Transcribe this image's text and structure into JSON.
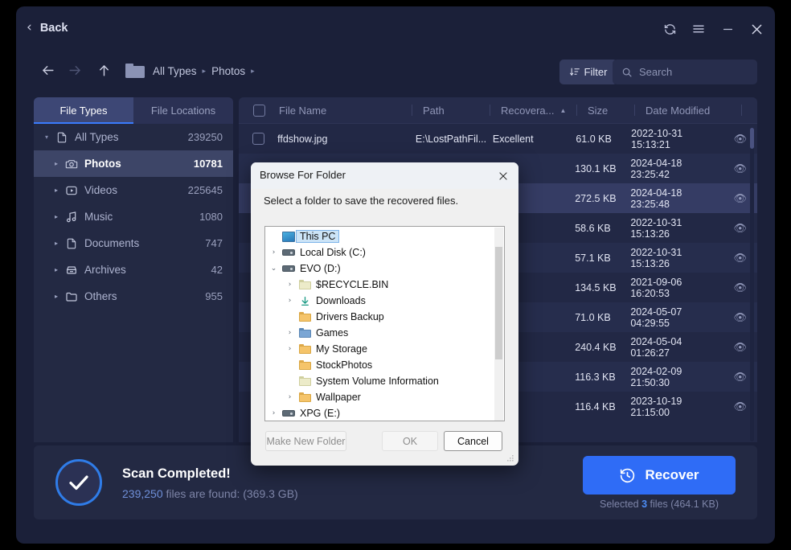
{
  "titlebar": {
    "back_label": "Back",
    "back_chevron": "‹",
    "refresh_icon": "refresh-icon",
    "menu_icon": "hamburger-menu-icon",
    "minimize_icon": "minimize-icon",
    "close_icon": "close-icon"
  },
  "toolbar": {
    "nav_back_icon": "arrow-left-icon",
    "nav_forward_icon": "arrow-right-icon",
    "nav_up_icon": "arrow-up-icon",
    "breadcrumb": [
      "All Types",
      "Photos"
    ],
    "breadcrumb_sep": "▸",
    "filter_label": "Filter",
    "search_placeholder": "Search"
  },
  "left_panel": {
    "tabs": [
      {
        "label": "File Types",
        "active": true
      },
      {
        "label": "File Locations",
        "active": false
      }
    ],
    "tree": [
      {
        "label": "All Types",
        "count": "239250",
        "icon": "document-icon",
        "expanded": true,
        "selected": false,
        "indent": false
      },
      {
        "label": "Photos",
        "count": "10781",
        "icon": "camera-icon",
        "expanded": false,
        "selected": true,
        "indent": true
      },
      {
        "label": "Videos",
        "count": "225645",
        "icon": "video-icon",
        "expanded": false,
        "selected": false,
        "indent": true
      },
      {
        "label": "Music",
        "count": "1080",
        "icon": "music-icon",
        "expanded": false,
        "selected": false,
        "indent": true
      },
      {
        "label": "Documents",
        "count": "747",
        "icon": "document-icon",
        "expanded": false,
        "selected": false,
        "indent": true
      },
      {
        "label": "Archives",
        "count": "42",
        "icon": "archive-icon",
        "expanded": false,
        "selected": false,
        "indent": true
      },
      {
        "label": "Others",
        "count": "955",
        "icon": "folder-icon",
        "expanded": false,
        "selected": false,
        "indent": true
      }
    ]
  },
  "table": {
    "columns": [
      "File Name",
      "Path",
      "Recovera...",
      "Size",
      "Date Modified"
    ],
    "sort_column": "Recovera...",
    "sort_direction": "asc",
    "sort_arrow": "▲",
    "header_checkbox_checked": false,
    "rows": [
      {
        "checked": false,
        "name": "ffdshow.jpg",
        "path": "E:\\LostPathFil...",
        "recoverability": "Excellent",
        "size": "61.0 KB",
        "date": "2022-10-31 15:13:21",
        "selected": false
      },
      {
        "checked": false,
        "name": "",
        "path": "",
        "recoverability": "",
        "size": "130.1 KB",
        "date": "2024-04-18 23:25:42",
        "selected": false
      },
      {
        "checked": true,
        "name": "",
        "path": "",
        "recoverability": "",
        "size": "272.5 KB",
        "date": "2024-04-18 23:25:48",
        "selected": true
      },
      {
        "checked": false,
        "name": "",
        "path": "",
        "recoverability": "",
        "size": "58.6 KB",
        "date": "2022-10-31 15:13:26",
        "selected": false
      },
      {
        "checked": true,
        "name": "",
        "path": "",
        "recoverability": "",
        "size": "57.1 KB",
        "date": "2022-10-31 15:13:26",
        "selected": false
      },
      {
        "checked": true,
        "name": "",
        "path": "",
        "recoverability": "",
        "size": "134.5 KB",
        "date": "2021-09-06 16:20:53",
        "selected": false
      },
      {
        "checked": false,
        "name": "",
        "path": "",
        "recoverability": "",
        "size": "71.0 KB",
        "date": "2024-05-07 04:29:55",
        "selected": false
      },
      {
        "checked": false,
        "name": "",
        "path": "",
        "recoverability": "",
        "size": "240.4 KB",
        "date": "2024-05-04 01:26:27",
        "selected": false
      },
      {
        "checked": false,
        "name": "",
        "path": "",
        "recoverability": "",
        "size": "116.3 KB",
        "date": "2024-02-09 21:50:30",
        "selected": false
      },
      {
        "checked": false,
        "name": "",
        "path": "",
        "recoverability": "",
        "size": "116.4 KB",
        "date": "2023-10-19 21:15:00",
        "selected": false
      }
    ],
    "eye_icon": "preview-eye-icon"
  },
  "bottom_bar": {
    "status_icon": "check-circle-icon",
    "title": "Scan Completed!",
    "found_count": "239,250",
    "found_rest": " files are found: (369.3 GB)",
    "recover_label": "Recover",
    "recover_icon": "restore-clock-icon",
    "selected_prefix": "Selected ",
    "selected_count": "3",
    "selected_suffix": " files (464.1 KB)"
  },
  "dialog": {
    "title": "Browse For Folder",
    "close_icon": "close-icon",
    "prompt": "Select a folder to save the recovered files.",
    "tree": [
      {
        "label": "This PC",
        "indent": 0,
        "expander": "",
        "icon": "this-pc-icon",
        "selected": true
      },
      {
        "label": "Local Disk (C:)",
        "indent": 0,
        "expander": "›",
        "icon": "drive-icon",
        "selected": false
      },
      {
        "label": "EVO (D:)",
        "indent": 0,
        "expander": "⌄",
        "icon": "drive-icon",
        "selected": false
      },
      {
        "label": "$RECYCLE.BIN",
        "indent": 1,
        "expander": "›",
        "icon": "folder-pale-icon",
        "selected": false
      },
      {
        "label": "Downloads",
        "indent": 1,
        "expander": "›",
        "icon": "download-icon",
        "selected": false
      },
      {
        "label": "Drivers Backup",
        "indent": 1,
        "expander": "",
        "icon": "folder-icon",
        "selected": false
      },
      {
        "label": "Games",
        "indent": 1,
        "expander": "›",
        "icon": "folder-games-icon",
        "selected": false
      },
      {
        "label": "My Storage",
        "indent": 1,
        "expander": "›",
        "icon": "folder-icon",
        "selected": false
      },
      {
        "label": "StockPhotos",
        "indent": 1,
        "expander": "",
        "icon": "folder-icon",
        "selected": false
      },
      {
        "label": "System Volume Information",
        "indent": 1,
        "expander": "",
        "icon": "folder-pale-icon",
        "selected": false
      },
      {
        "label": "Wallpaper",
        "indent": 1,
        "expander": "›",
        "icon": "folder-icon",
        "selected": false
      },
      {
        "label": "XPG (E:)",
        "indent": 0,
        "expander": "›",
        "icon": "drive-icon",
        "selected": false
      }
    ],
    "buttons": {
      "make_new_folder": "Make New Folder",
      "ok": "OK",
      "cancel": "Cancel"
    }
  },
  "colors": {
    "accent_blue": "#2f6cf6",
    "tab_underline": "#3a7bfd",
    "window_bg": "#1b2039",
    "panel_bg": "#232943",
    "selected_row": "#353c64"
  }
}
